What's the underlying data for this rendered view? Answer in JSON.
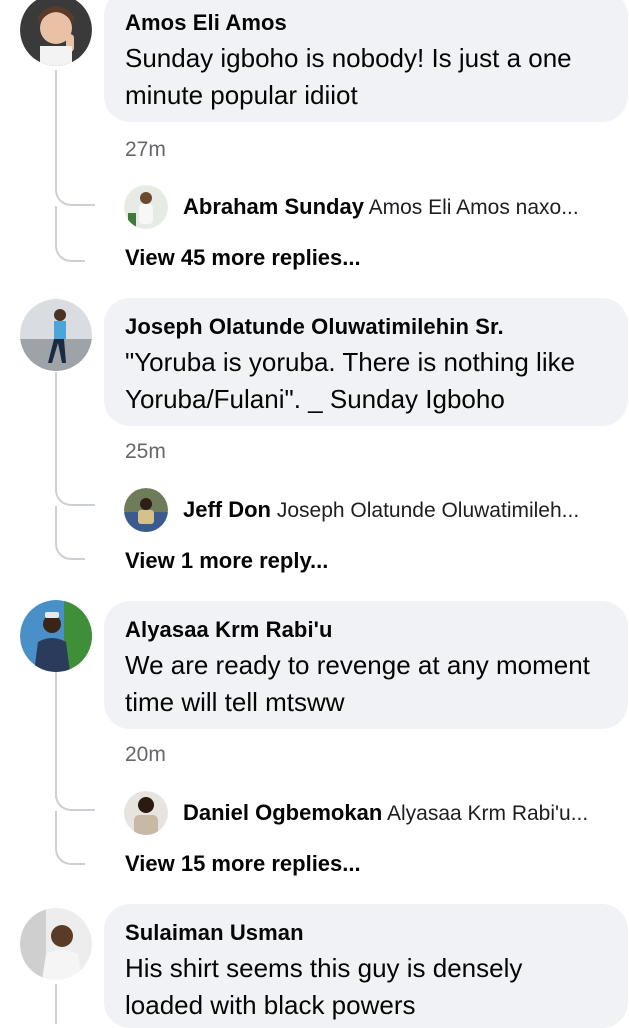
{
  "comments": [
    {
      "author": "Amos Eli Amos",
      "text": "Sunday igboho is nobody! Is just a one minute popular idiiot",
      "time": "27m",
      "reply": {
        "author": "Abraham Sunday",
        "text": "Amos Eli Amos naxo..."
      },
      "view_more": "View 45 more replies..."
    },
    {
      "author": "Joseph Olatunde Oluwatimilehin Sr.",
      "text": "\"Yoruba is yoruba. There is nothing like Yoruba/Fulani\". _ Sunday Igboho",
      "time": "25m",
      "reply": {
        "author": "Jeff Don",
        "text": "Joseph Olatunde Oluwatimileh..."
      },
      "view_more": "View 1 more reply..."
    },
    {
      "author": "Alyasaa Krm Rabi'u",
      "text": "We are ready to revenge at any moment time will tell mtsww",
      "time": "20m",
      "reply": {
        "author": "Daniel Ogbemokan",
        "text": "Alyasaa Krm Rabi'u..."
      },
      "view_more": "View 15 more replies..."
    },
    {
      "author": "Sulaiman Usman",
      "text": "His shirt seems this guy is densely loaded with black powers"
    }
  ],
  "colors": {
    "bubble": "#f0f2f5",
    "thread_line": "#ccd0d5",
    "muted_text": "#65676b"
  }
}
